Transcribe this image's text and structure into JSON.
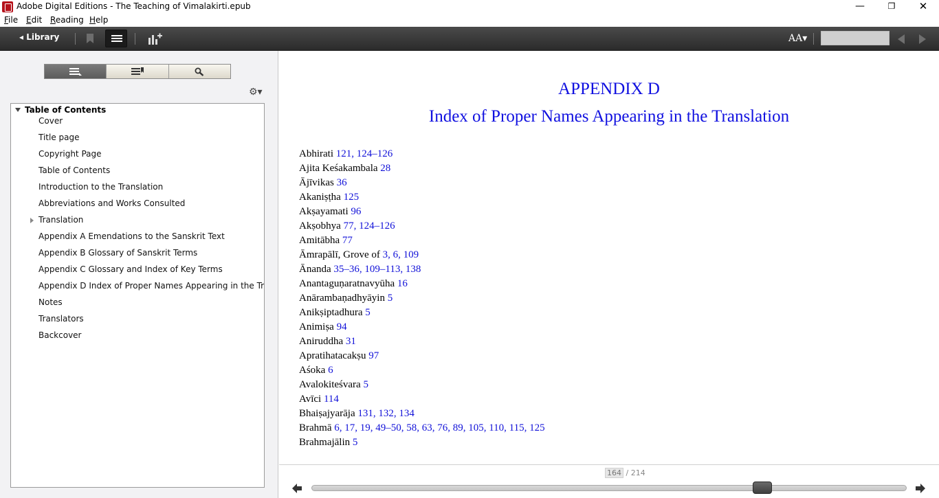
{
  "window": {
    "title": "Adobe Digital Editions - The Teaching of Vimalakirti.epub",
    "minimize_glyph": "—",
    "maximize_glyph": "❐",
    "close_glyph": "✕"
  },
  "menu": {
    "items": [
      {
        "accel": "F",
        "rest": "ile"
      },
      {
        "accel": "E",
        "rest": "dit"
      },
      {
        "accel": "R",
        "rest": "eading"
      },
      {
        "accel": "H",
        "rest": "elp"
      }
    ]
  },
  "toolbar": {
    "library_label": "◂ Library",
    "font_size_label": "AA▾",
    "search_value": "",
    "icons": [
      "bookmark-icon",
      "toc-list-icon",
      "chart-plus-icon",
      "prev-arrow-icon",
      "next-arrow-icon"
    ]
  },
  "sidebar": {
    "settings_glyph": "⚙▾",
    "tabs": [
      "toc-tab-icon",
      "bookmarks-tab-icon",
      "search-tab-icon"
    ],
    "toc_header": "Table of Contents",
    "toc_items": [
      {
        "label": "Cover"
      },
      {
        "label": "Title page"
      },
      {
        "label": "Copyright Page"
      },
      {
        "label": "Table of Contents"
      },
      {
        "label": "Introduction to the Translation"
      },
      {
        "label": "Abbreviations and Works Consulted"
      },
      {
        "label": "Translation",
        "expandable": true
      },
      {
        "label": "Appendix A Emendations to the Sanskrit Text"
      },
      {
        "label": "Appendix B Glossary of Sanskrit Terms"
      },
      {
        "label": "Appendix C Glossary and Index of Key Terms"
      },
      {
        "label": "Appendix D Index of Proper Names Appearing in the Translati"
      },
      {
        "label": "Notes"
      },
      {
        "label": "Translators"
      },
      {
        "label": "Backcover"
      }
    ]
  },
  "content": {
    "title": "APPENDIX D",
    "subtitle": "Index of Proper Names Appearing in the Translation",
    "title_color": "#1010e0",
    "link_color": "#1010d8",
    "entries": [
      {
        "name": "Abhirati",
        "pages": "121, 124–126"
      },
      {
        "name": "Ajita Keśakambala",
        "pages": "28"
      },
      {
        "name": "Ājīvikas",
        "pages": "36"
      },
      {
        "name": "Akaniṣṭha",
        "pages": "125"
      },
      {
        "name": "Akṣayamati",
        "pages": "96"
      },
      {
        "name": "Akṣobhya",
        "pages": "77, 124–126"
      },
      {
        "name": "Amitābha",
        "pages": "77"
      },
      {
        "name": "Āmrapālī, Grove of",
        "pages": "3, 6, 109"
      },
      {
        "name": "Ānanda",
        "pages": "35–36, 109–113, 138"
      },
      {
        "name": "Anantaguṇaratnavyūha",
        "pages": "16"
      },
      {
        "name": "Anārambaṇadhyāyin",
        "pages": "5"
      },
      {
        "name": "Anikṣiptadhura",
        "pages": "5"
      },
      {
        "name": "Animiṣa",
        "pages": "94"
      },
      {
        "name": "Aniruddha",
        "pages": "31"
      },
      {
        "name": "Apratihatacakṣu",
        "pages": "97"
      },
      {
        "name": "Aśoka",
        "pages": "6"
      },
      {
        "name": "Avalokiteśvara",
        "pages": "5"
      },
      {
        "name": "Avīci",
        "pages": "114"
      },
      {
        "name": "Bhaiṣajyarāja",
        "pages": "131, 132, 134"
      },
      {
        "name": "Brahmā",
        "pages": "6, 17, 19, 49–50, 58, 63, 76, 89, 105, 110, 115, 125"
      },
      {
        "name": "Brahmajālin",
        "pages": "5"
      }
    ]
  },
  "navigation": {
    "current_page": "164",
    "page_separator": "/",
    "total_pages": "214",
    "progress_fraction": 0.7664
  }
}
